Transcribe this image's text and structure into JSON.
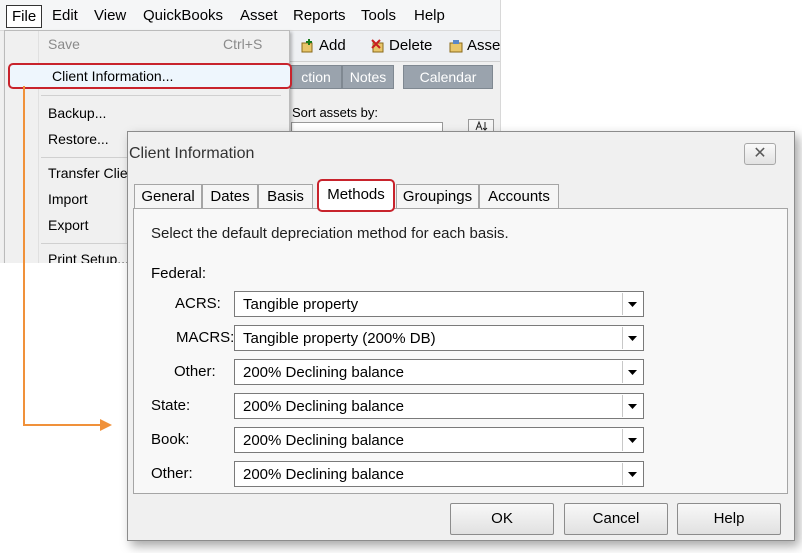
{
  "menubar": {
    "items": [
      "File",
      "Edit",
      "View",
      "QuickBooks",
      "Asset",
      "Reports",
      "Tools",
      "Help"
    ]
  },
  "toolbar": {
    "add_label": "Add",
    "delete_label": "Delete",
    "asset_label": "Asse"
  },
  "background_tabs": [
    "ction",
    "Notes",
    "Calendar"
  ],
  "sort": {
    "label": "Sort assets by:"
  },
  "file_menu": {
    "save_label": "Save",
    "save_shortcut": "Ctrl+S",
    "client_info_label": "Client Information...",
    "backup_label": "Backup...",
    "restore_label": "Restore...",
    "transfer_label": "Transfer Clie",
    "import_label": "Import",
    "export_label": "Export",
    "print_setup_label": "Print Setup..."
  },
  "dialog": {
    "title": "Client Information",
    "close_glyph": "✕",
    "tabs": [
      "General",
      "Dates",
      "Basis",
      "Methods",
      "Groupings",
      "Accounts"
    ],
    "active_tab": "Methods",
    "instruction": "Select the default depreciation method for each basis.",
    "federal_label": "Federal:",
    "rows": [
      {
        "label": "ACRS:",
        "value": "Tangible property"
      },
      {
        "label": "MACRS:",
        "value": "Tangible property (200% DB)"
      },
      {
        "label": "Other:",
        "value": "200% Declining balance"
      },
      {
        "label": "State:",
        "value": "200% Declining balance"
      },
      {
        "label": "Book:",
        "value": "200% Declining balance"
      },
      {
        "label": "Other:",
        "value": "200% Declining balance"
      }
    ],
    "buttons": {
      "ok": "OK",
      "cancel": "Cancel",
      "help": "Help"
    }
  },
  "colors": {
    "highlight_border": "#c8232c",
    "connector_arrow": "#f0913a"
  }
}
